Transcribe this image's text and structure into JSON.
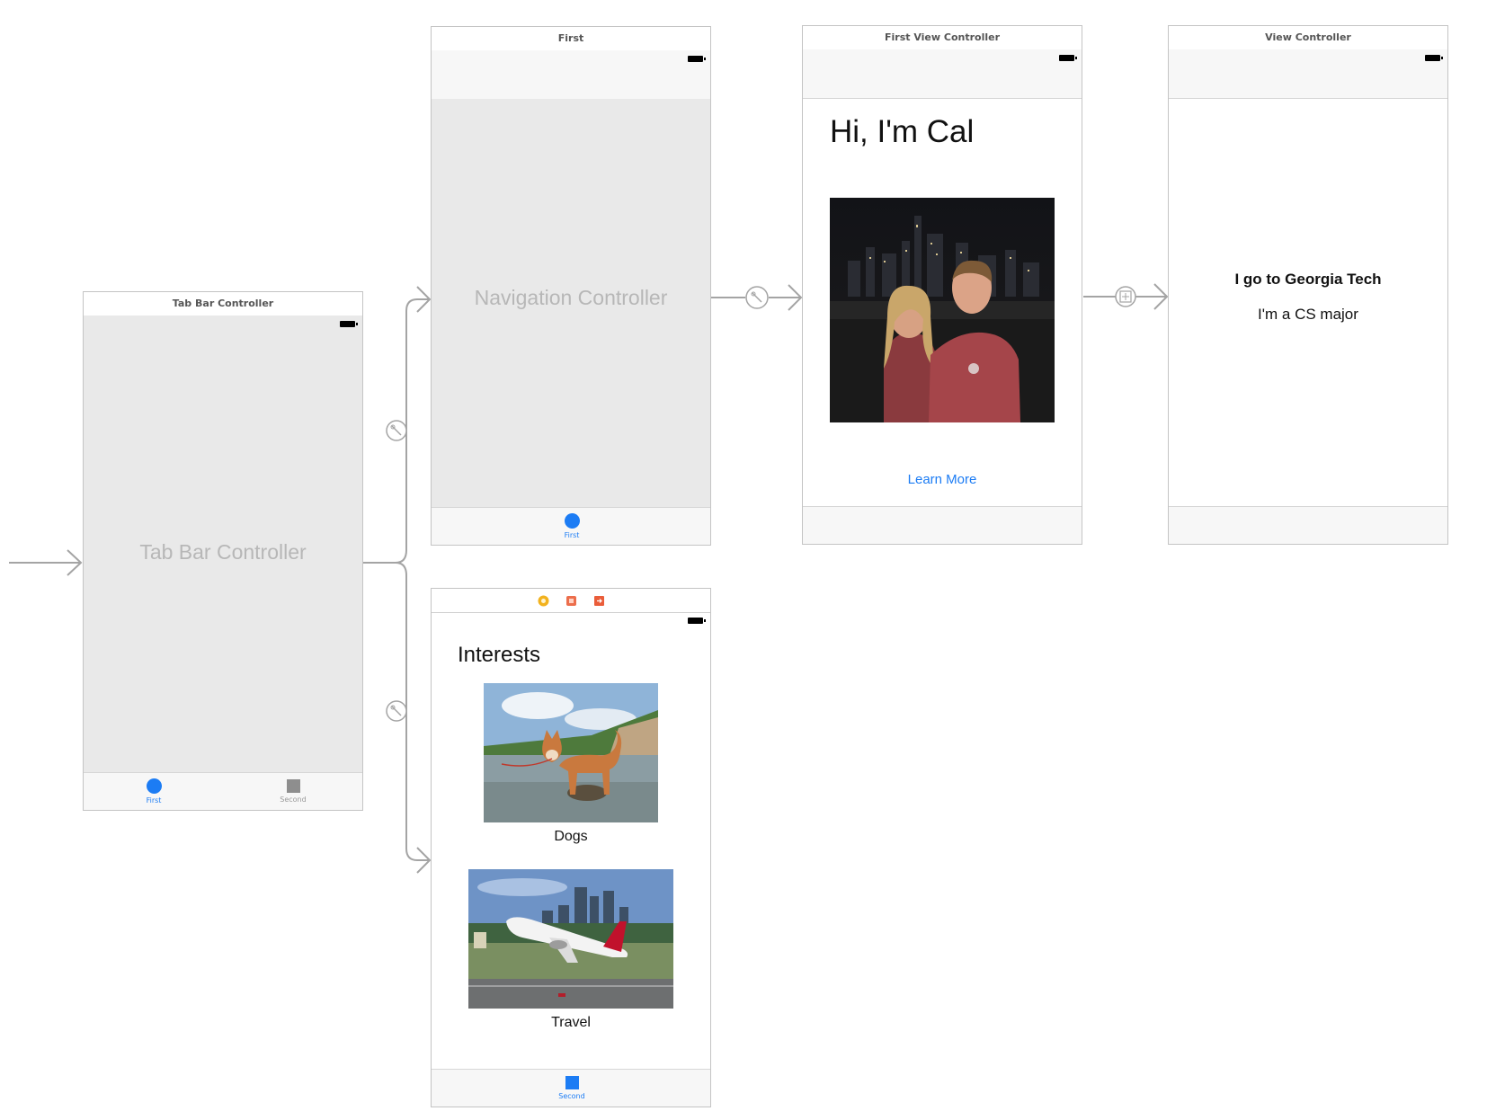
{
  "tab_bar_controller": {
    "scene_title": "Tab Bar Controller",
    "center_label": "Tab Bar Controller",
    "tabs": [
      {
        "label": "First",
        "icon": "circle-icon",
        "active": true
      },
      {
        "label": "Second",
        "icon": "square-icon",
        "active": false
      }
    ]
  },
  "navigation_controller": {
    "scene_title": "First",
    "center_label": "Navigation Controller",
    "tab_label": "First"
  },
  "first_view_controller": {
    "scene_title": "First View Controller",
    "heading": "Hi, I'm Cal",
    "photo": "couple-photo",
    "button_label": "Learn More"
  },
  "view_controller": {
    "scene_title": "View Controller",
    "line1": "I go to Georgia Tech",
    "line2": "I'm a CS major"
  },
  "interests_scene": {
    "title_icons": [
      "view-controller-icon",
      "first-responder-icon",
      "exit-icon"
    ],
    "heading": "Interests",
    "items": [
      {
        "label": "Dogs",
        "image": "shiba-dog-photo"
      },
      {
        "label": "Travel",
        "image": "airplane-photo"
      }
    ],
    "tab_label": "Second"
  },
  "colors": {
    "accent": "#1c7cf4",
    "canvas_bg": "#ffffff",
    "scene_body_gray": "#e9e9e9",
    "segue_line": "#9e9e9e"
  }
}
